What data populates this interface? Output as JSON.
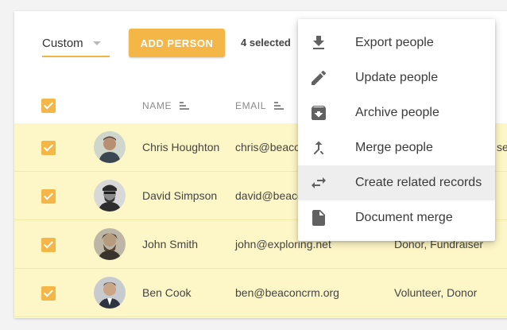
{
  "toolbar": {
    "filter_value": "Custom",
    "add_person_label": "ADD PERSON",
    "selected_text": "4 selected"
  },
  "table": {
    "columns": [
      {
        "label": "NAME"
      },
      {
        "label": "EMAIL"
      }
    ],
    "rows": [
      {
        "name": "Chris Houghton",
        "email": "chris@beaco",
        "tags": "",
        "tags_fragment": "sea",
        "checked": true
      },
      {
        "name": "David Simpson",
        "email": "david@beaco",
        "tags": "",
        "tags_fragment": "",
        "checked": true
      },
      {
        "name": "John Smith",
        "email": "john@exploring.net",
        "tags": "Donor, Fundraiser",
        "tags_fragment": "",
        "checked": true
      },
      {
        "name": "Ben Cook",
        "email": "ben@beaconcrm.org",
        "tags": "Volunteer, Donor",
        "tags_fragment": "",
        "checked": true
      }
    ]
  },
  "menu": {
    "items": [
      {
        "label": "Export people",
        "icon": "download-icon"
      },
      {
        "label": "Update people",
        "icon": "pencil-icon"
      },
      {
        "label": "Archive people",
        "icon": "archive-icon"
      },
      {
        "label": "Merge people",
        "icon": "merge-icon"
      },
      {
        "label": "Create related records",
        "icon": "swap-arrows-icon"
      },
      {
        "label": "Document merge",
        "icon": "document-icon"
      }
    ]
  },
  "colors": {
    "accent": "#f4b647",
    "row_selected": "#fdf6c6",
    "menu_hover": "#eeeeee"
  }
}
